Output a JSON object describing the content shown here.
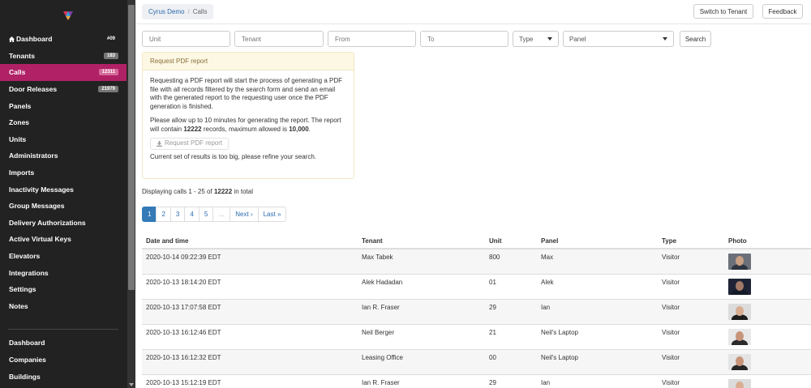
{
  "sidebar": {
    "logo_icon": "brand-logo-icon",
    "items": [
      {
        "label": "Dashboard",
        "icon": "home-icon",
        "badge": "#09"
      },
      {
        "label": "Tenants",
        "badge": "183"
      },
      {
        "label": "Calls",
        "badge": "12311",
        "active": true
      },
      {
        "label": "Door Releases",
        "badge": "21979"
      },
      {
        "label": "Panels"
      },
      {
        "label": "Zones"
      },
      {
        "label": "Units"
      },
      {
        "label": "Administrators"
      },
      {
        "label": "Imports"
      },
      {
        "label": "Inactivity Messages"
      },
      {
        "label": "Group Messages"
      },
      {
        "label": "Delivery Authorizations"
      },
      {
        "label": "Active Virtual Keys"
      },
      {
        "label": "Elevators"
      },
      {
        "label": "Integrations"
      },
      {
        "label": "Settings"
      },
      {
        "label": "Notes"
      }
    ],
    "secondary_items": [
      {
        "label": "Dashboard"
      },
      {
        "label": "Companies"
      },
      {
        "label": "Buildings"
      }
    ]
  },
  "header": {
    "breadcrumb_root": "Cyrus Demo",
    "breadcrumb_sep": "/",
    "breadcrumb_current": "Calls",
    "switch_label": "Switch to Tenant",
    "feedback_label": "Feedback"
  },
  "filters": {
    "unit_placeholder": "Unit",
    "tenant_placeholder": "Tenant",
    "from_placeholder": "From",
    "to_placeholder": "To",
    "type_value": "Type",
    "panel_value": "Panel",
    "search_label": "Search"
  },
  "pdf": {
    "heading": "Request PDF report",
    "para1": "Requesting a PDF report will start the process of generating a PDF file with all records filtered by the search form and send an email with the generated report to the requesting user once the PDF generation is finished.",
    "para2_prefix": "Please allow up to 10 minutes for generating the report. The report will contain ",
    "para2_records": "12222",
    "para2_middle": " records, maximum allowed is ",
    "para2_max": "10,000",
    "para2_end": ".",
    "button_label": "Request PDF report",
    "button_icon": "download-icon",
    "warning": "Current set of results is too big, please refine your search."
  },
  "results": {
    "prefix": "Displaying calls ",
    "range": "1 - 25",
    "middle": " of ",
    "total": "12222",
    "suffix": " in total"
  },
  "pagination": [
    "1",
    "2",
    "3",
    "4",
    "5",
    "…",
    "Next ›",
    "Last »"
  ],
  "table": {
    "headers": [
      "Date and time",
      "Tenant",
      "Unit",
      "Panel",
      "Type",
      "Photo"
    ],
    "rows": [
      {
        "date": "2020-10-14 09:22:39 EDT",
        "tenant": "Max Tabek",
        "unit": "800",
        "panel": "Max",
        "type": "Visitor",
        "photo_bg": "#6c7078",
        "face": "#c9a084",
        "body": "#2e3540"
      },
      {
        "date": "2020-10-13 18:14:20 EDT",
        "tenant": "Alek Hadadan",
        "unit": "01",
        "panel": "Alek",
        "type": "Visitor",
        "photo_bg": "#1e2436",
        "face": "#a47a66",
        "body": "#141a28"
      },
      {
        "date": "2020-10-13 17:07:58 EDT",
        "tenant": "Ian R. Fraser",
        "unit": "29",
        "panel": "Ian",
        "type": "Visitor",
        "photo_bg": "#dcdcdc",
        "face": "#d8ad92",
        "body": "#1c1c1c"
      },
      {
        "date": "2020-10-13 16:12:46 EDT",
        "tenant": "Neil Berger",
        "unit": "21",
        "panel": "Neil's Laptop",
        "type": "Visitor",
        "photo_bg": "#e8e8e8",
        "face": "#c89479",
        "body": "#2a2a2a"
      },
      {
        "date": "2020-10-13 16:12:32 EDT",
        "tenant": "Leasing Office",
        "unit": "00",
        "panel": "Neil's Laptop",
        "type": "Visitor",
        "photo_bg": "#e4e4e4",
        "face": "#c89479",
        "body": "#262626"
      },
      {
        "date": "2020-10-13 15:12:19 EDT",
        "tenant": "Ian R. Fraser",
        "unit": "29",
        "panel": "Ian",
        "type": "Visitor",
        "photo_bg": "#dcdcdc",
        "face": "#d8ad92",
        "body": "#1c1c1c"
      }
    ]
  }
}
